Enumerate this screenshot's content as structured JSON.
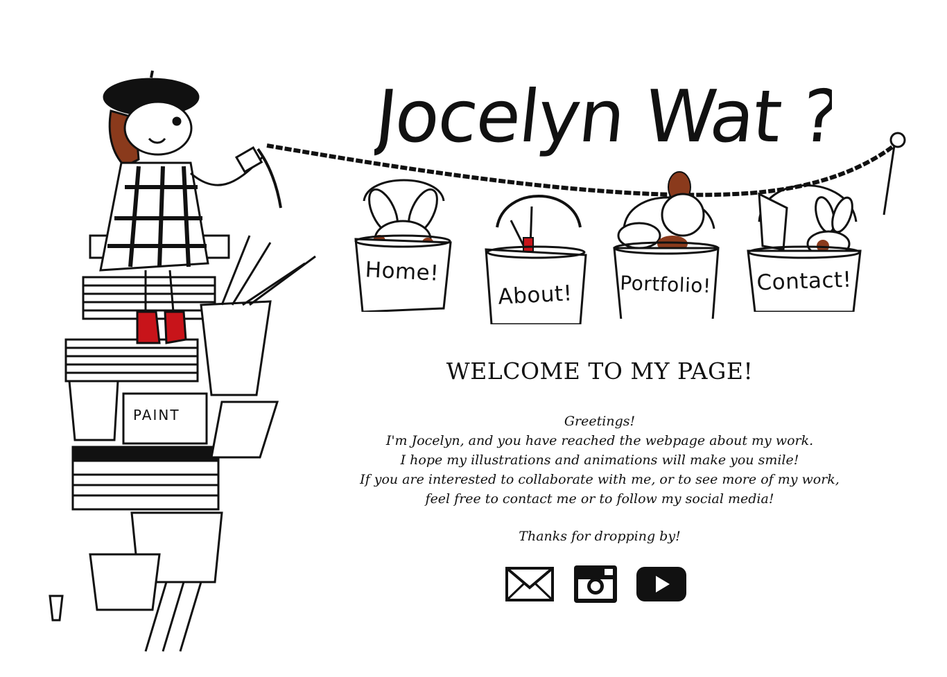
{
  "header": {
    "logo_text": "Jocelyn Wat ?!"
  },
  "nav": {
    "items": [
      {
        "label": "Home!"
      },
      {
        "label": "About!"
      },
      {
        "label": "Portfolio!"
      },
      {
        "label": "Contact!"
      }
    ]
  },
  "illustration": {
    "paint_label": "PAINT"
  },
  "main": {
    "welcome": "WELCOME TO MY PAGE!",
    "intro_lines": [
      "Greetings!",
      "I'm Jocelyn, and you have reached the  webpage about my work.",
      "I hope my illustrations and animations will make you smile!",
      "If you are interested to collaborate with me, or to see more of my work,",
      "feel free to contact me or to follow my social media!"
    ],
    "thanks": "Thanks for dropping by!"
  },
  "social": {
    "icons": [
      "mail-icon",
      "instagram-icon",
      "youtube-icon"
    ]
  },
  "colors": {
    "ink": "#111111",
    "accent_red": "#c8141a",
    "hair_brown": "#8a3a1c",
    "background": "#ffffff"
  }
}
